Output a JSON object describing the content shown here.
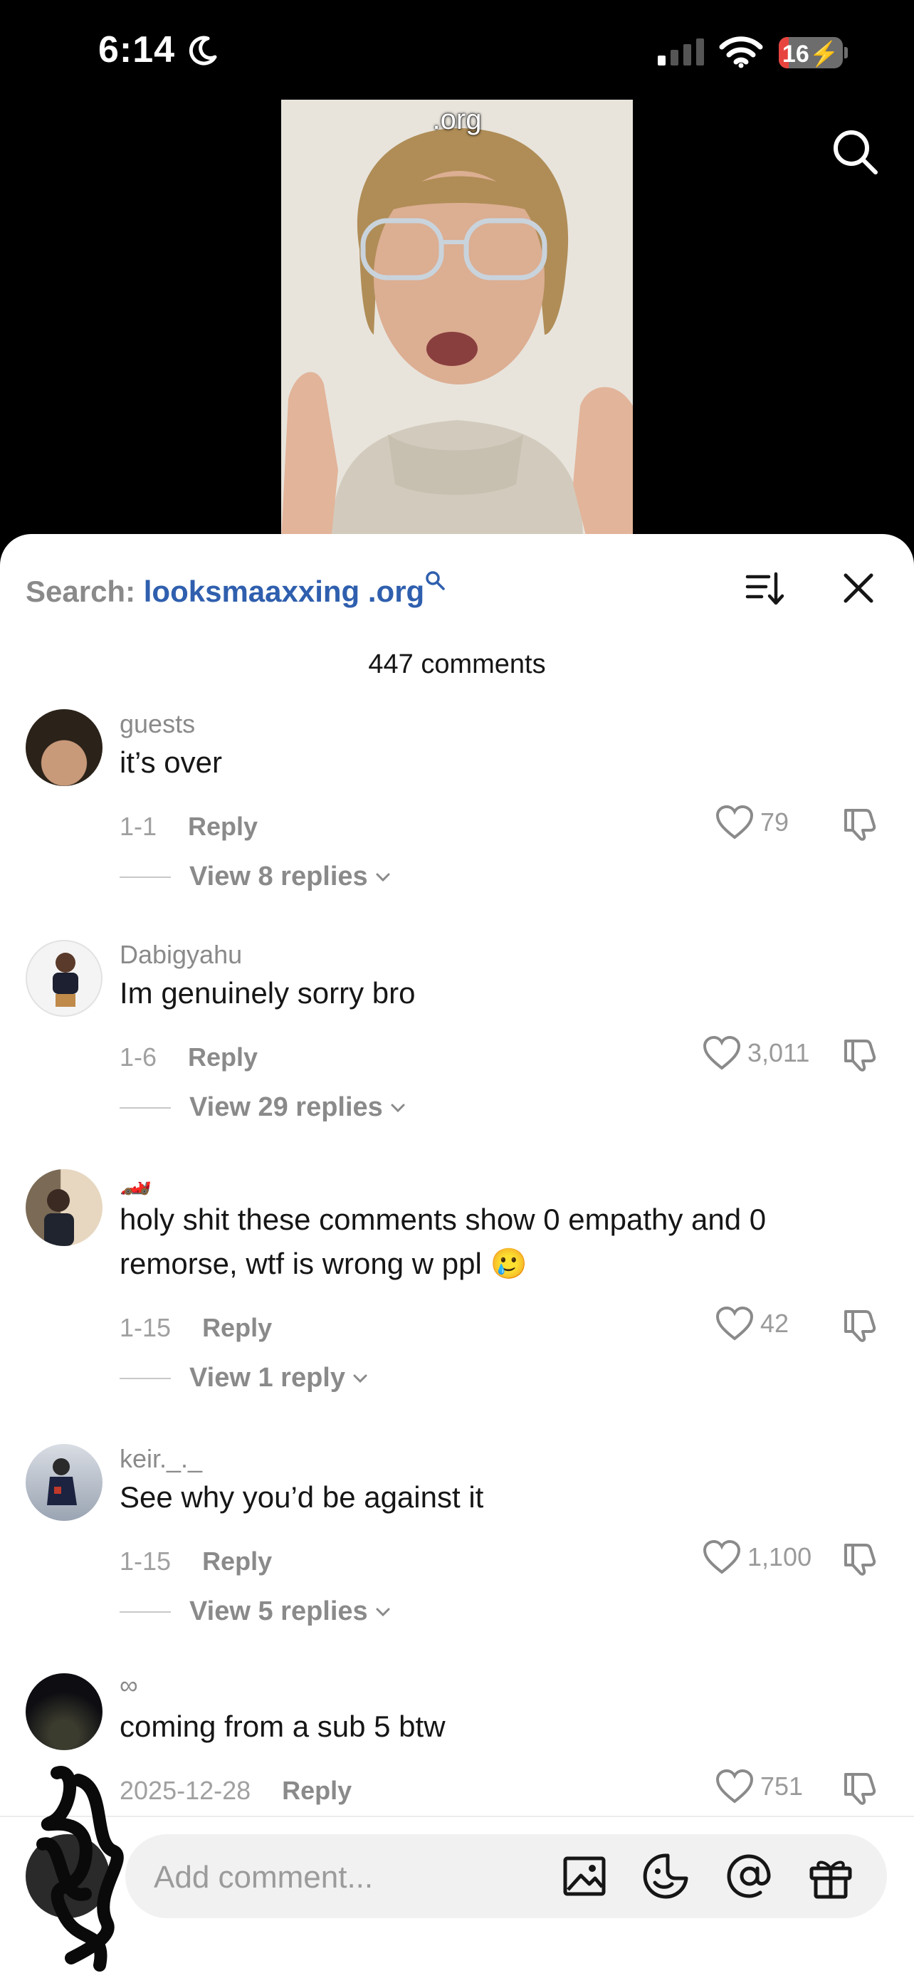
{
  "status_bar": {
    "time": "6:14",
    "battery": "16",
    "battery_level": 0.16
  },
  "video": {
    "caption": ".org"
  },
  "sheet": {
    "search_label": "Search:",
    "search_keyword": "looksmaaxxing .org",
    "comment_count": "447 comments"
  },
  "comments": [
    {
      "username": "guests",
      "text": "it’s over",
      "date": "1-1",
      "reply": "Reply",
      "likes": "79",
      "view_replies": "View 8 replies"
    },
    {
      "username": "Dabigyahu",
      "text": "Im genuinely sorry bro",
      "date": "1-6",
      "reply": "Reply",
      "likes": "3,011",
      "view_replies": "View 29 replies"
    },
    {
      "username": "🏎️",
      "text": "holy shit these comments show 0 empathy and 0 remorse, wtf is wrong w ppl 🥲",
      "date": "1-15",
      "reply": "Reply",
      "likes": "42",
      "view_replies": "View 1 reply"
    },
    {
      "username": "keir._._",
      "text": "See why you’d be against it",
      "date": "1-15",
      "reply": "Reply",
      "likes": "1,100",
      "view_replies": "View 5 replies"
    },
    {
      "username": "∞",
      "text": "coming from a sub 5 btw",
      "date": "2025-12-28",
      "reply": "Reply",
      "likes": "751"
    }
  ],
  "composer": {
    "placeholder": "Add comment..."
  },
  "icons": {
    "top_search": "search-icon",
    "sort": "sort-icon",
    "close": "close-icon",
    "like": "heart-icon",
    "dislike": "thumbs-down-icon",
    "image": "image-icon",
    "emoji": "emoji-icon",
    "mention": "at-icon",
    "gift": "gift-icon"
  },
  "colors": {
    "accent_link": "#2f5fae",
    "battery_low": "#e8443f"
  }
}
